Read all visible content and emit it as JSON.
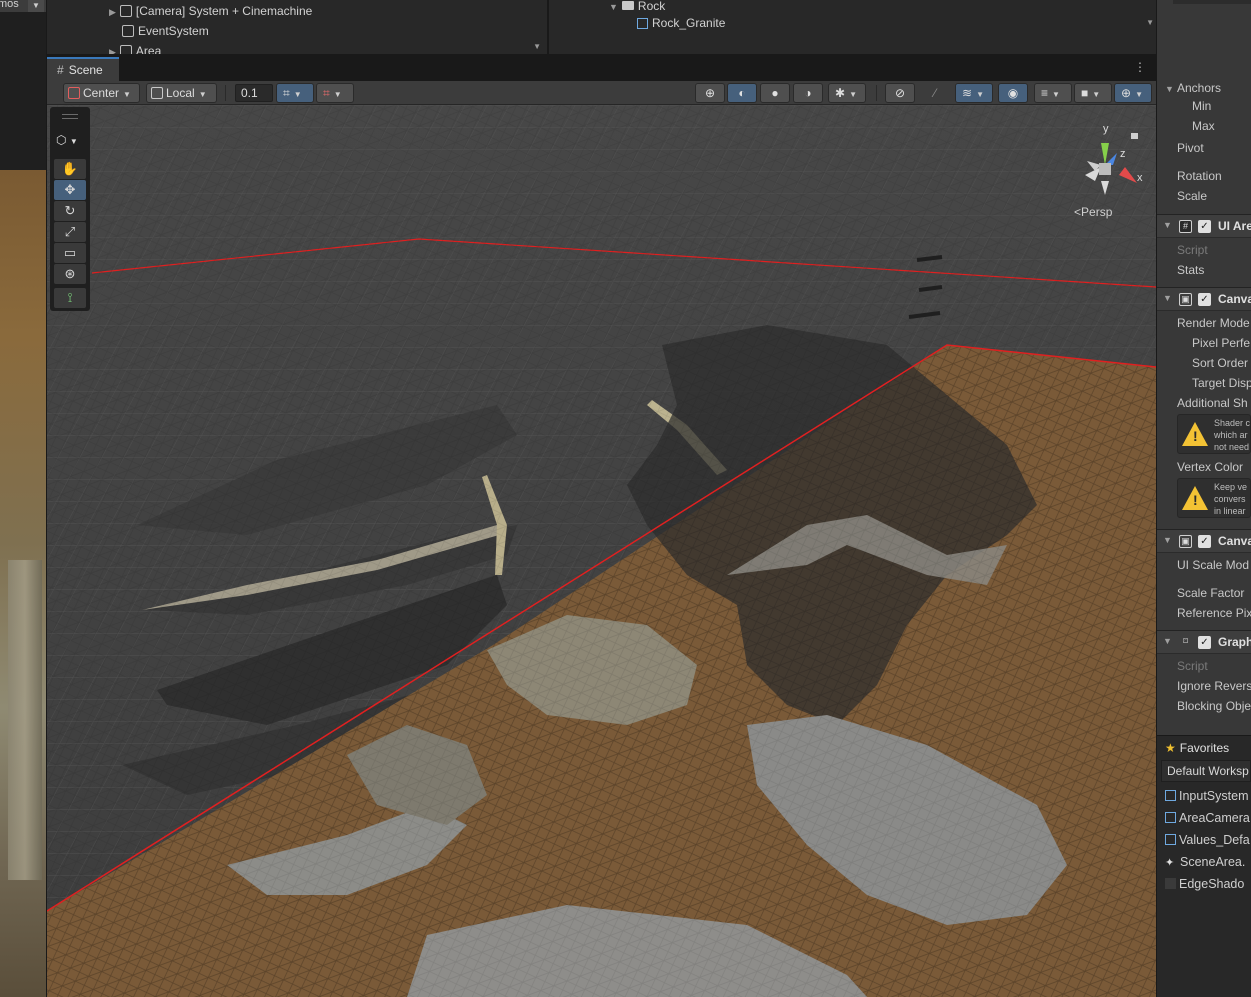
{
  "game_view": {
    "label": "mos",
    "dropdown_glyph": "▼"
  },
  "hierarchy": {
    "items": [
      {
        "label": "[Camera] System + Cinemachine"
      },
      {
        "label": "EventSystem"
      },
      {
        "label": "Area"
      }
    ]
  },
  "project": {
    "items": [
      {
        "label": "Rock"
      },
      {
        "label": "Rock_Granite"
      }
    ]
  },
  "scene": {
    "tab_label": "Scene",
    "pivot_label": "Center",
    "space_label": "Local",
    "snap_value": "0.1",
    "view_label": "Persp",
    "axis_y": "y",
    "axis_z": "z",
    "axis_x": "x"
  },
  "inspector": {
    "anchors": "Anchors",
    "min": "Min",
    "max": "Max",
    "pivot": "Pivot",
    "rotation": "Rotation",
    "scale": "Scale",
    "ui_area_title": "UI Are",
    "script": "Script",
    "stats": "Stats",
    "canvas_title": "Canva",
    "render_mode": "Render Mode",
    "pixel_perfect": "Pixel Perfe",
    "sort_order": "Sort Order",
    "target_display": "Target Disp",
    "additional_shader": "Additional Sh",
    "warn1_line1": "Shader c",
    "warn1_line2": "which ar",
    "warn1_line3": "not need",
    "vertex_color": "Vertex Color",
    "warn2_line1": "Keep ve",
    "warn2_line2": "convers",
    "warn2_line3": "in linear",
    "canvas_scaler_title": "Canva",
    "ui_scale_mode": "UI Scale Mod",
    "scale_factor": "Scale Factor",
    "reference_pixels": "Reference Pix",
    "graphic_raycaster_title": "Graph",
    "script2": "Script",
    "ignore_reversed": "Ignore Revers",
    "blocking_objects": "Blocking Obje"
  },
  "favorites": {
    "header": "Favorites",
    "workspace": "Default Worksp",
    "items": [
      {
        "label": "InputSystem"
      },
      {
        "label": "AreaCamera"
      },
      {
        "label": "Values_Defa"
      },
      {
        "label": "SceneArea."
      },
      {
        "label": "EdgeShado"
      }
    ]
  },
  "colors": {
    "accent": "#3a79bb",
    "active_button": "#46607c",
    "terrain_dirt": "#7a5a38",
    "terrain_stone": "#8a8a86",
    "bounds_line": "#e02020"
  },
  "icons": {
    "move_tool": "move-icon",
    "hand_tool": "hand-icon",
    "rotate_tool": "rotate-icon",
    "scale_tool": "scale-icon",
    "rect_tool": "rect-icon",
    "transform_tool": "transform-icon",
    "custom_tool": "custom-tool-icon"
  }
}
